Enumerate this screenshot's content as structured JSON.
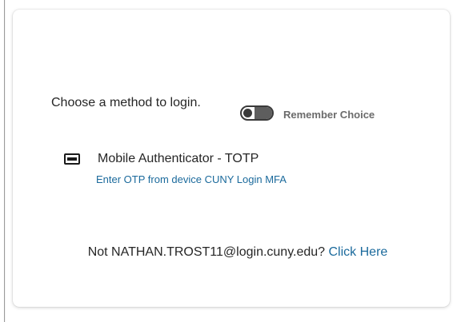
{
  "login": {
    "prompt": "Choose a method to login.",
    "remember_choice": {
      "label": "Remember Choice",
      "enabled": false
    },
    "methods": [
      {
        "icon": "device-card-icon",
        "title": "Mobile Authenticator - TOTP",
        "subtitle": "Enter OTP from device CUNY Login MFA"
      }
    ],
    "not_user": {
      "prefix": "Not NATHAN.TROST11@login.cuny.edu? ",
      "link": "Click Here"
    }
  },
  "colors": {
    "link": "#1b6a9c",
    "text": "#262626",
    "muted": "#6b6b6b"
  }
}
